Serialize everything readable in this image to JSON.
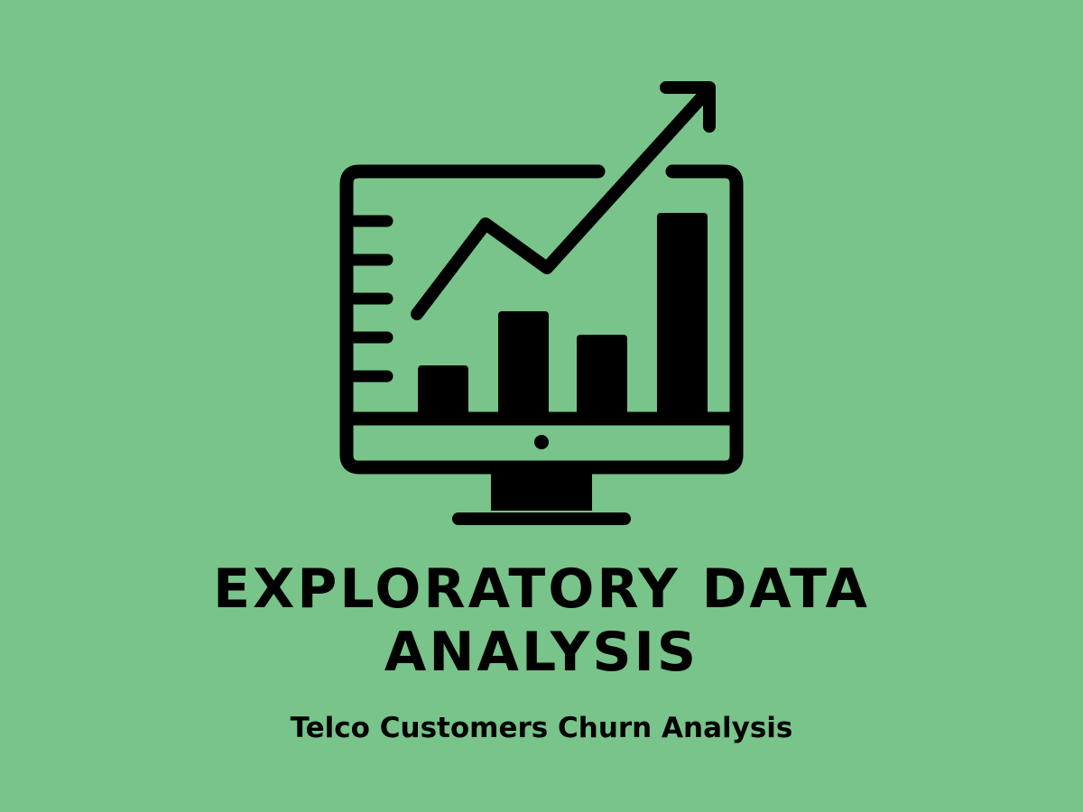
{
  "colors": {
    "background": "#78C48A",
    "ink": "#000000"
  },
  "illustration": {
    "icon": "monitor-growth-chart-icon",
    "bar_levels": [
      0.24,
      0.51,
      0.39,
      1.0
    ]
  },
  "title": {
    "line1": "EXPLORATORY DATA",
    "line2": "ANALYSIS"
  },
  "subtitle": "Telco Customers Churn Analysis"
}
